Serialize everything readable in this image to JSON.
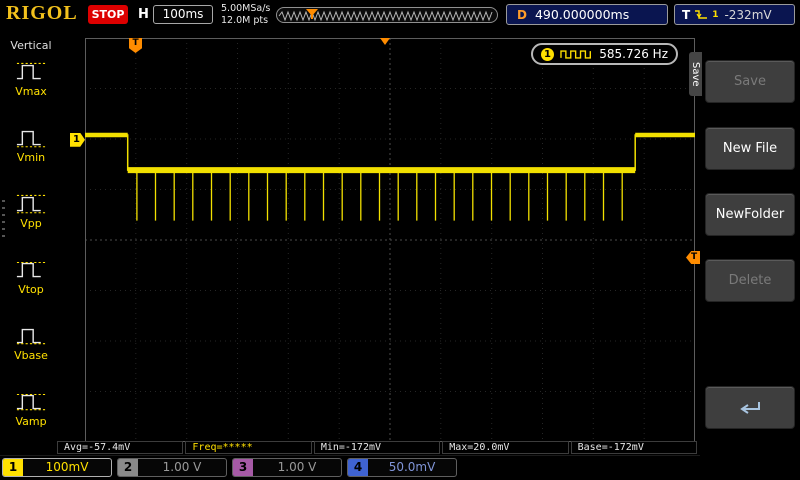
{
  "brand": "RIGOL",
  "topbar": {
    "run_state": "STOP",
    "h_label": "H",
    "timebase": "100ms",
    "sample_rate": "5.00MSa/s",
    "mem_depth": "12.0M pts",
    "d_label": "D",
    "delay": "490.000000ms",
    "t_label": "T",
    "trigger_source": "1",
    "trigger_level": "-232mV"
  },
  "sidebar": {
    "title": "Vertical",
    "items": [
      {
        "label": "Vmax"
      },
      {
        "label": "Vmin"
      },
      {
        "label": "Vpp"
      },
      {
        "label": "Vtop"
      },
      {
        "label": "Vbase"
      },
      {
        "label": "Vamp"
      }
    ]
  },
  "display": {
    "freq_counter": {
      "channel": "1",
      "value": "585.726 Hz"
    },
    "trigger_flag": "T",
    "trigger_level_tag": "T",
    "ch1_marker": "1"
  },
  "measurements": [
    {
      "text": "Avg=-57.4mV",
      "color": "#e8e8e8"
    },
    {
      "text": "Freq=*****",
      "color": "#ffe000"
    },
    {
      "text": "Min=-172mV",
      "color": "#e8e8e8"
    },
    {
      "text": "Max=20.0mV",
      "color": "#e8e8e8"
    },
    {
      "text": "Base=-172mV",
      "color": "#e8e8e8"
    }
  ],
  "channels": [
    {
      "num": "1",
      "value": "100mV",
      "color": "#ffe000",
      "value_color": "#ffe000",
      "active": true
    },
    {
      "num": "2",
      "value": "1.00 V",
      "color": "#8a8a8a",
      "value_color": "#9a9a9a",
      "active": false
    },
    {
      "num": "3",
      "value": "1.00 V",
      "color": "#a65aa6",
      "value_color": "#9a9a9a",
      "active": false
    },
    {
      "num": "4",
      "value": "50.0mV",
      "color": "#3f63d2",
      "value_color": "#8095d8",
      "active": false
    }
  ],
  "menu": {
    "tab_label": "Save",
    "buttons": [
      {
        "label": "Save",
        "enabled": false
      },
      {
        "label": "New File",
        "enabled": true
      },
      {
        "label": "NewFolder",
        "enabled": true
      },
      {
        "label": "Delete",
        "enabled": false
      }
    ]
  },
  "waveform": {
    "color": "#f2e000",
    "trace": {
      "high_frac": 0.24,
      "low_frac": 0.327,
      "spike_bottom_frac": 0.452,
      "drop_x_frac": 0.07,
      "rise_x_frac": 0.902,
      "spike_start_frac": 0.085,
      "spike_pitch_frac": 0.0306,
      "spike_count": 27
    },
    "trigger_pos_frac": 0.492,
    "trigger_time_flag_frac": 0.082,
    "trigger_level_frac": 0.542,
    "ch1_level_frac": 0.252
  }
}
